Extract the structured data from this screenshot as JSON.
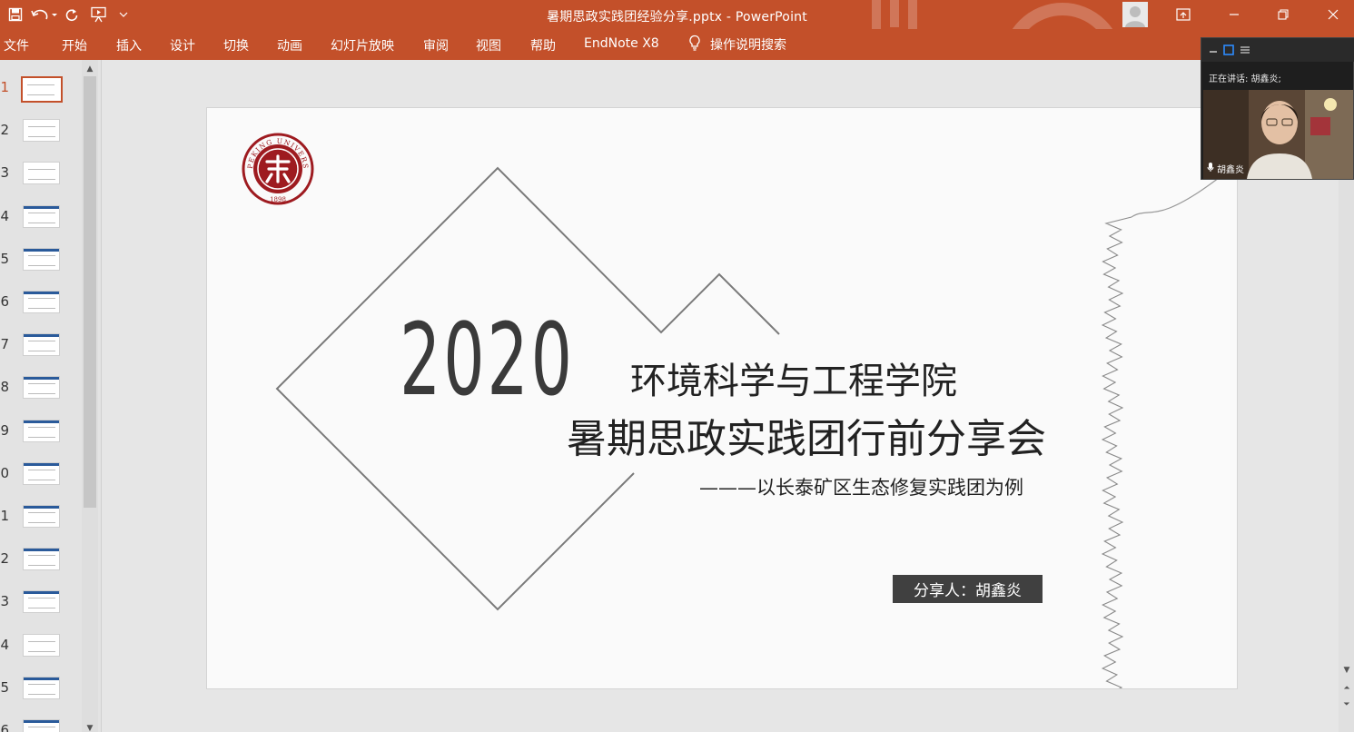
{
  "window": {
    "title": "暑期思政实践团经验分享.pptx  -  PowerPoint",
    "theme_color": "#c3502a"
  },
  "ribbon": {
    "tabs": [
      "文件",
      "开始",
      "插入",
      "设计",
      "切换",
      "动画",
      "幻灯片放映",
      "审阅",
      "视图",
      "帮助",
      "EndNote X8"
    ],
    "tell_me": "操作说明搜索"
  },
  "thumbnails": {
    "numbers": [
      "1",
      "2",
      "3",
      "4",
      "5",
      "6",
      "7",
      "8",
      "9",
      "0",
      "1",
      "2",
      "3",
      "4",
      "5",
      "6"
    ],
    "active_index": 0
  },
  "slide": {
    "year": "2020",
    "title_line1": "环境科学与工程学院",
    "title_line2": "暑期思政实践团行前分享会",
    "subtitle": "———以长泰矿区生态修复实践团为例",
    "presenter": "分享人：胡鑫炎",
    "seal": {
      "top_text": "PEKING UNIVERSITY",
      "year_text": "1898",
      "color": "#9e1b20"
    }
  },
  "video_call": {
    "speaking_label": "正在讲话: 胡鑫炎;",
    "participant_name": "胡鑫炎"
  }
}
